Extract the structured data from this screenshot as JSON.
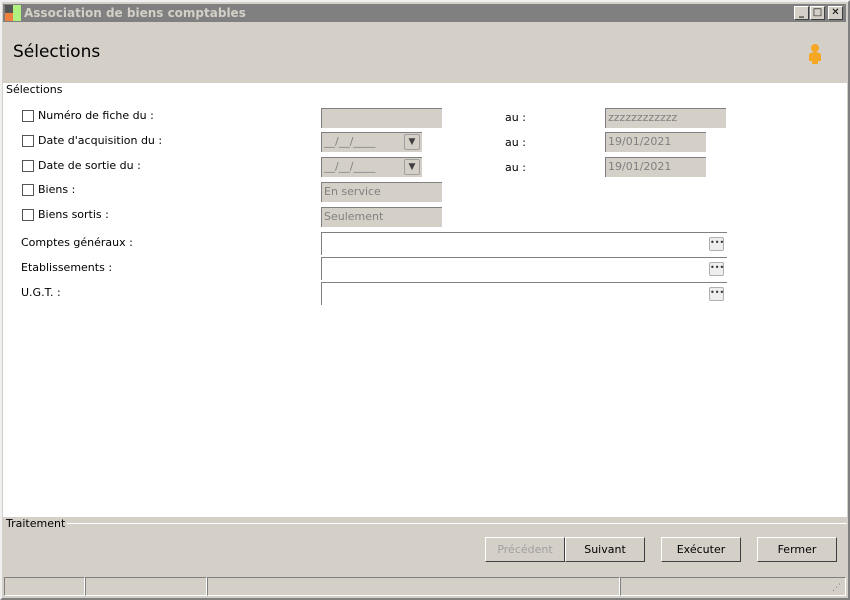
{
  "window": {
    "title": "Association de biens comptables"
  },
  "header": {
    "title": "Sélections"
  },
  "selections": {
    "legend": "Sélections",
    "rows": [
      {
        "label": "Numéro de fiche du :",
        "from": "",
        "to_label": "au :",
        "to": "zzzzzzzzzzzz"
      },
      {
        "label": "Date d'acquisition du :",
        "from": "__/__/____",
        "to_label": "au :",
        "to": "19/01/2021"
      },
      {
        "label": "Date de sortie du :",
        "from": "__/__/____",
        "to_label": "au :",
        "to": "19/01/2021"
      },
      {
        "label": "Biens :",
        "value": "En service"
      },
      {
        "label": "Biens sortis :",
        "value": "Seulement"
      }
    ],
    "lookups": [
      {
        "label": "Comptes généraux :",
        "value": ""
      },
      {
        "label": "Etablissements :",
        "value": ""
      },
      {
        "label": "U.G.T. :",
        "value": ""
      }
    ]
  },
  "traitement": {
    "legend": "Traitement"
  },
  "buttons": {
    "previous": "Précédent",
    "next": "Suivant",
    "execute": "Exécuter",
    "close": "Fermer"
  }
}
